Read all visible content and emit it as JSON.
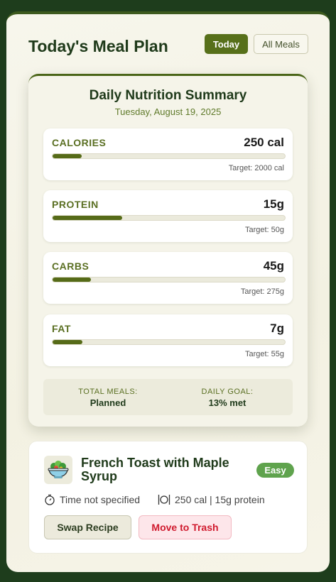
{
  "header": {
    "title": "Today's Meal Plan",
    "today_label": "Today",
    "all_meals_label": "All Meals"
  },
  "summary": {
    "title": "Daily Nutrition Summary",
    "date": "Tuesday, August 19, 2025",
    "nutrients": [
      {
        "label": "CALORIES",
        "value": "250 cal",
        "target": "Target: 2000 cal",
        "progress": 0.125
      },
      {
        "label": "PROTEIN",
        "value": "15g",
        "target": "Target: 50g",
        "progress": 0.3
      },
      {
        "label": "CARBS",
        "value": "45g",
        "target": "Target: 275g",
        "progress": 0.164
      },
      {
        "label": "FAT",
        "value": "7g",
        "target": "Target: 55g",
        "progress": 0.127
      }
    ],
    "totals": {
      "meals_label": "TOTAL MEALS:",
      "meals_value": "Planned",
      "goal_label": "DAILY GOAL:",
      "goal_value": "13% met"
    }
  },
  "meal": {
    "icon": "salad-bowl-icon",
    "name": "French Toast with Maple Syrup",
    "difficulty": "Easy",
    "time": "Time not specified",
    "nutrition": "250 cal | 15g protein",
    "swap_label": "Swap Recipe",
    "trash_label": "Move to Trash"
  },
  "colors": {
    "primary": "#57701a",
    "background": "#1e3d1c",
    "badge": "#5fa34d",
    "danger": "#d01a2e"
  }
}
